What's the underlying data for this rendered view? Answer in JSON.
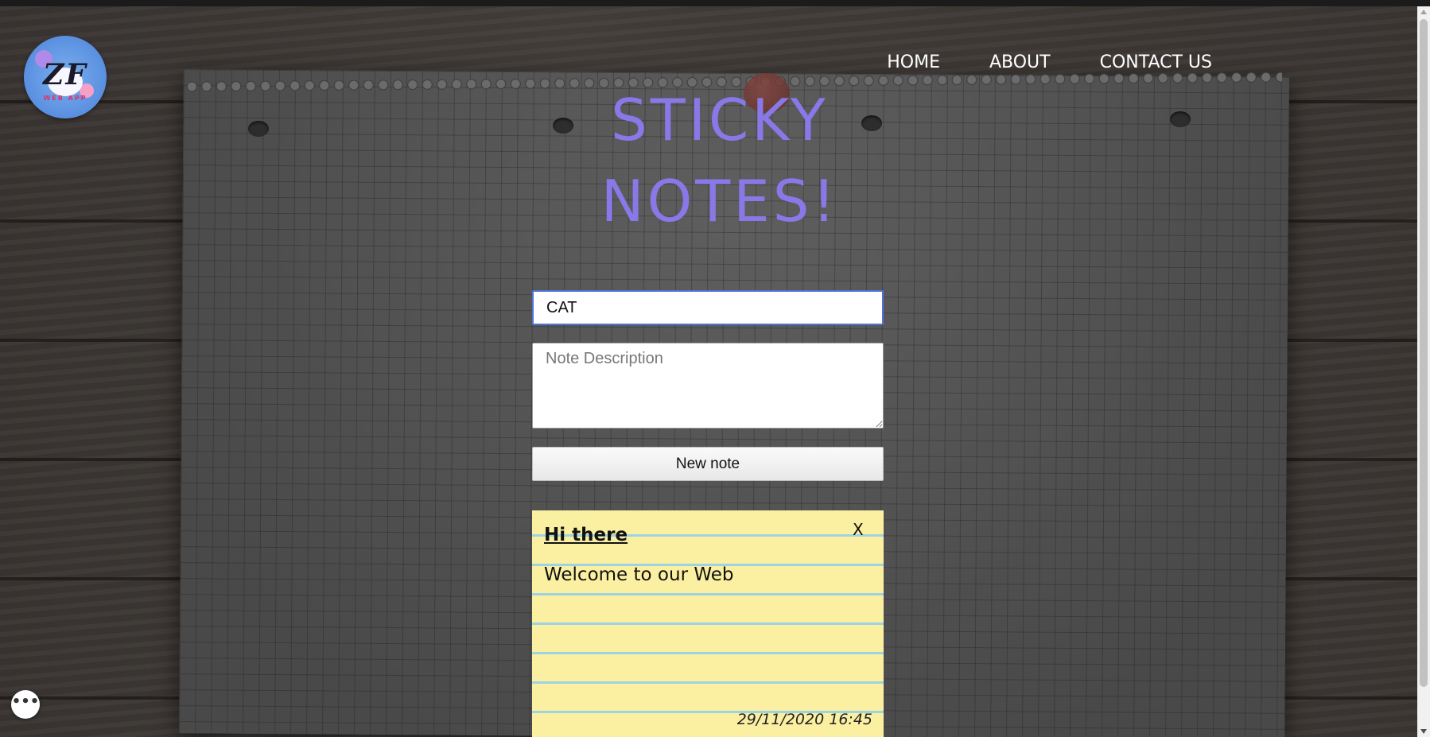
{
  "logo": {
    "letters": "ZF",
    "subtitle": "WEB APP"
  },
  "nav": {
    "items": [
      {
        "label": "HOME"
      },
      {
        "label": "ABOUT"
      },
      {
        "label": "CONTACT US"
      }
    ]
  },
  "hero": {
    "title_line1": "STICKY",
    "title_line2": "NOTES!"
  },
  "form": {
    "title_value": "CAT",
    "description_placeholder": "Note Description",
    "new_note_label": "New note"
  },
  "notes": [
    {
      "title": "Hi there",
      "body": "Welcome to our Web",
      "close_label": "X",
      "timestamp": "29/11/2020 16:45"
    }
  ],
  "chat": {
    "label": "•••"
  },
  "colors": {
    "title": "#8878e8",
    "note_background": "#fbf0a2",
    "note_lines": "#9ed3e4",
    "input_focus_border": "#4d74d8"
  }
}
